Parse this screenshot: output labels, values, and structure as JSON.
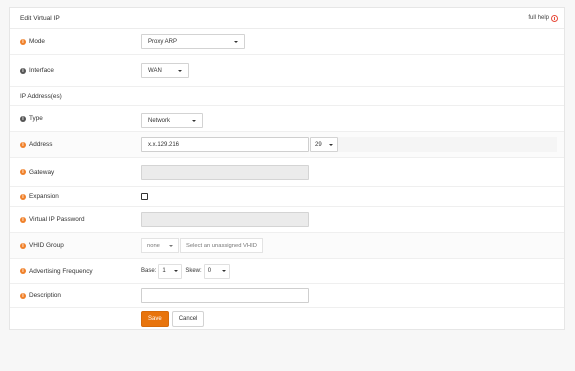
{
  "panel": {
    "title": "Edit Virtual IP",
    "help_label": "full help"
  },
  "fields": {
    "mode": {
      "label": "Mode",
      "value": "Proxy ARP"
    },
    "interface": {
      "label": "Interface",
      "value": "WAN"
    },
    "section_ip": {
      "label": "IP Address(es)"
    },
    "type": {
      "label": "Type",
      "value": "Network"
    },
    "address": {
      "label": "Address",
      "value": "x.x.129.216",
      "mask": "29"
    },
    "gateway": {
      "label": "Gateway",
      "value": ""
    },
    "expansion": {
      "label": "Expansion",
      "checked": false
    },
    "vip_password": {
      "label": "Virtual IP Password",
      "value": ""
    },
    "vhid_group": {
      "label": "VHID Group",
      "value": "none",
      "button": "Select an unassigned VHID"
    },
    "adv_freq": {
      "label": "Advertising Frequency",
      "base_label": "Base:",
      "base_value": "1",
      "skew_label": "Skew:",
      "skew_value": "0"
    },
    "description": {
      "label": "Description",
      "value": ""
    }
  },
  "actions": {
    "save": "Save",
    "cancel": "Cancel"
  },
  "colors": {
    "accent": "#e8740c",
    "info_icon": "#f0812a",
    "help_icon": "#e74c3c"
  }
}
